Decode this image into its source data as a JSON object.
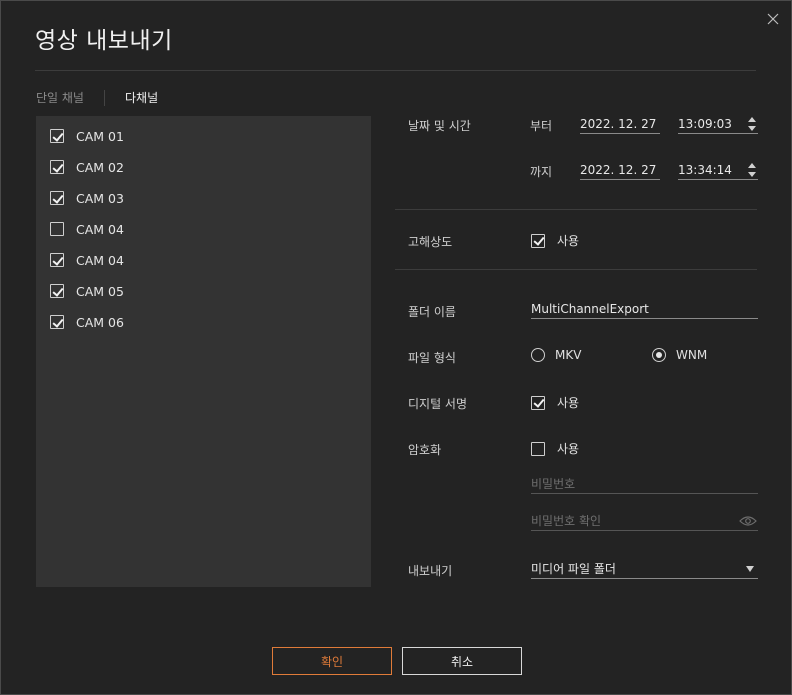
{
  "dialog": {
    "title": "영상 내보내기"
  },
  "tabs": {
    "single": "단일 채널",
    "multi": "다채널"
  },
  "channels": [
    {
      "label": "CAM 01",
      "checked": true
    },
    {
      "label": "CAM 02",
      "checked": true
    },
    {
      "label": "CAM 03",
      "checked": true
    },
    {
      "label": "CAM 04",
      "checked": false
    },
    {
      "label": "CAM 04",
      "checked": true
    },
    {
      "label": "CAM 05",
      "checked": true
    },
    {
      "label": "CAM 06",
      "checked": true
    }
  ],
  "datetime": {
    "label": "날짜 및 시간",
    "from_label": "부터",
    "from_date": "2022. 12. 27",
    "from_time": "13:09:03",
    "to_label": "까지",
    "to_date": "2022. 12. 27",
    "to_time": "13:34:14"
  },
  "high_res": {
    "label": "고해상도",
    "option": "사용",
    "checked": true
  },
  "folder": {
    "label": "폴더 이름",
    "value": "MultiChannelExport"
  },
  "file_format": {
    "label": "파일 형식",
    "options": [
      "MKV",
      "WNM"
    ],
    "selected": "WNM"
  },
  "digital_sign": {
    "label": "디지털 서명",
    "option": "사용",
    "checked": true
  },
  "encryption": {
    "label": "암호화",
    "option": "사용",
    "checked": false,
    "password_placeholder": "비밀번호",
    "confirm_placeholder": "비밀번호 확인"
  },
  "export": {
    "label": "내보내기",
    "value": "미디어 파일 폴더"
  },
  "buttons": {
    "confirm": "확인",
    "cancel": "취소"
  },
  "colors": {
    "accent": "#e07b39",
    "panel": "#333333",
    "background": "#232323"
  }
}
